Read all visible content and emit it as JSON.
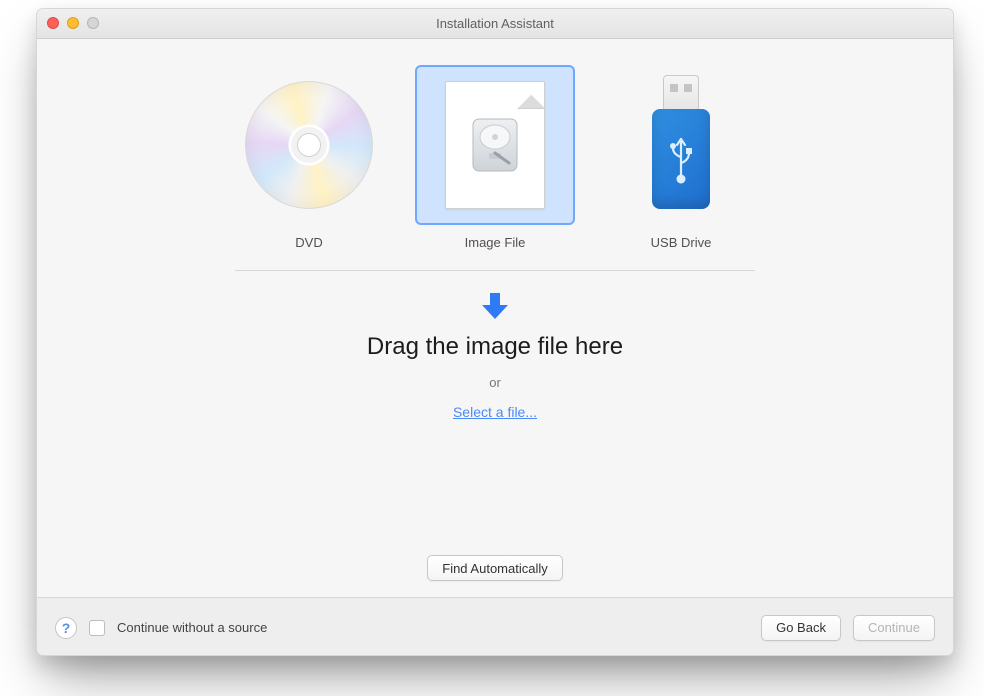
{
  "window": {
    "title": "Installation Assistant"
  },
  "sources": {
    "items": [
      {
        "id": "dvd",
        "label": "DVD"
      },
      {
        "id": "image",
        "label": "Image File"
      },
      {
        "id": "usb",
        "label": "USB Drive"
      }
    ],
    "selected": "image"
  },
  "dropzone": {
    "title": "Drag the image file here",
    "or": "or",
    "select_file": "Select a file..."
  },
  "buttons": {
    "find_automatically": "Find Automatically",
    "go_back": "Go Back",
    "continue": "Continue"
  },
  "footer": {
    "continue_without_source": "Continue without a source",
    "continue_enabled": false
  },
  "colors": {
    "accent": "#2f7bf6",
    "link": "#4b8af7"
  }
}
